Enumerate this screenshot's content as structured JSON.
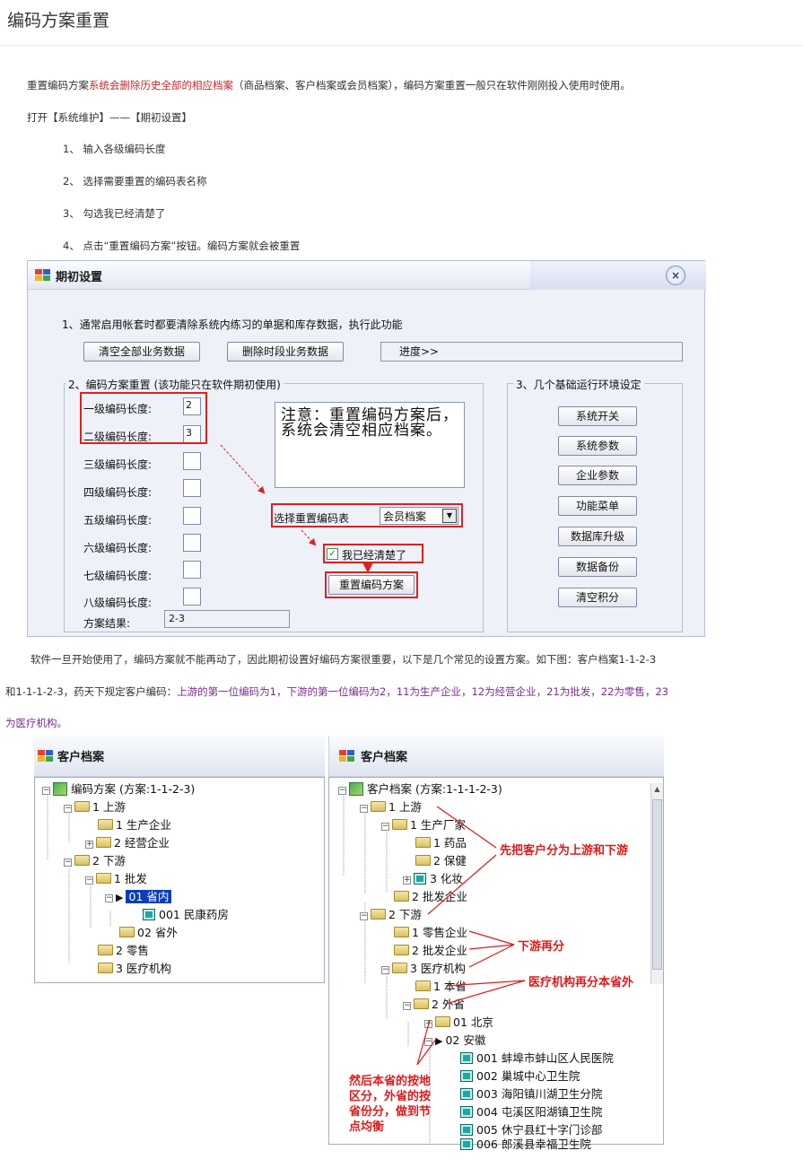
{
  "article": {
    "title": "编码方案重置",
    "intro_prefix": "重置编码方案",
    "intro_red": "系统会删除历史全部的相应档案",
    "intro_suffix": "（商品档案、客户档案或会员档案），编码方案重置一般只在软件刚刚投入使用时使用。",
    "open_path": "打开【系统维护】——【期初设置】",
    "steps": [
      "1、 输入各级编码长度",
      "2、 选择需要重置的编码表名称",
      "3、 勾选我已经清楚了",
      "4、 点击“重置编码方案”按钮。编码方案就会被重置"
    ],
    "body_line1": "软件一旦开始使用了，编码方案就不能再动了，因此期初设置好编码方案很重要，以下是几个常见的设置方案。如下图：客户档案1-1-2-3",
    "body_line2_prefix": "和1-1-1-2-3，药天下规定客户编码：",
    "body_line2_purple": "上游的第一位编码为1，下游的第一位编码为2，11为生产企业，12为经营企业，21为批发，22为零售，23",
    "body_line3_purple": "为医疗机构。"
  },
  "dialog": {
    "title": "期初设置",
    "close_label": "×",
    "section1_text": "1、通常启用帐套时都要清除系统内练习的单据和库存数据，执行此功能",
    "clear_all_label": "清空全部业务数据",
    "delete_period_label": "删除时段业务数据",
    "progress_label": "进度>>",
    "section2_title": "2、编码方案重置 (该功能只在软件期初使用)",
    "levels": [
      {
        "label": "一级编码长度:",
        "value": "2"
      },
      {
        "label": "二级编码长度:",
        "value": "3"
      },
      {
        "label": "三级编码长度:",
        "value": ""
      },
      {
        "label": "四级编码长度:",
        "value": ""
      },
      {
        "label": "五级编码长度:",
        "value": ""
      },
      {
        "label": "六级编码长度:",
        "value": ""
      },
      {
        "label": "七级编码长度:",
        "value": ""
      },
      {
        "label": "八级编码长度:",
        "value": ""
      }
    ],
    "result_label": "方案结果:",
    "result_value": "2-3",
    "notice_text": "注意：重置编码方案后，系统会清空相应档案。",
    "select_label": "选择重置编码表",
    "select_value": "会员档案",
    "confirm_label": "我已经清楚了",
    "reset_button_label": "重置编码方案",
    "section3_title": "3、几个基础运行环境设定",
    "env_buttons": [
      "系统开关",
      "系统参数",
      "企业参数",
      "功能菜单",
      "数据库升级",
      "数据备份",
      "清空积分"
    ]
  },
  "left_tree": {
    "header": "客户档案",
    "nodes": [
      "编码方案 (方案:1-1-2-3)",
      "1 上游",
      "1 生产企业",
      "2 经营企业",
      "2 下游",
      "1 批发",
      "01 省内",
      "001 民康药房",
      "02 省外",
      "2 零售",
      "3 医疗机构"
    ]
  },
  "right_tree": {
    "header": "客户档案",
    "nodes": [
      "客户档案 (方案:1-1-1-2-3)",
      "1 上游",
      "1 生产厂家",
      "1 药品",
      "2 保健",
      "3 化妆",
      "2 批发企业",
      "2 下游",
      "1 零售企业",
      "2 批发企业",
      "3 医疗机构",
      "1 本省",
      "2 外省",
      "01 北京",
      "02 安徽",
      "001 蚌埠市蚌山区人民医院",
      "002 巢城中心卫生院",
      "003 海阳镇川湖卫生分院",
      "004 屯溪区阳湖镇卫生院",
      "005 休宁县红十字门诊部",
      "006 郎溪县幸福卫生院"
    ],
    "annotations": [
      "先把客户分为上游和下游",
      "下游再分",
      "医疗机构再分本省外",
      "然后本省的按地区分，外省的按省份分，做到节点均衡"
    ]
  }
}
